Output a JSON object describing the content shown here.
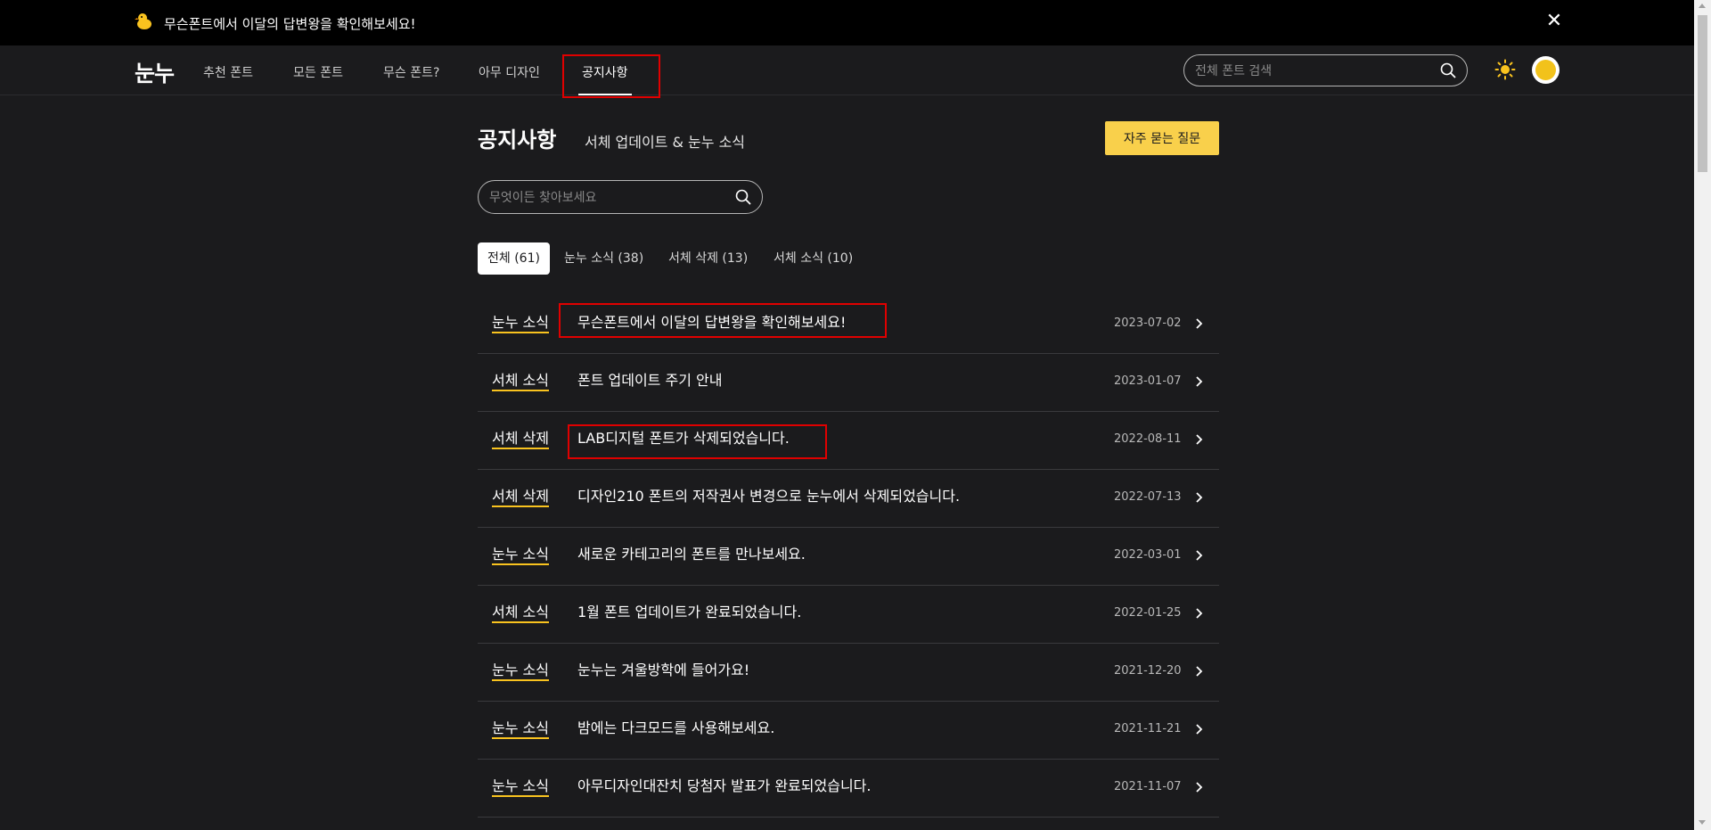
{
  "banner": {
    "text": "무슨폰트에서 이달의 답변왕을 확인해보세요!",
    "close": "✕"
  },
  "nav": {
    "logo": "눈누",
    "items": [
      {
        "label": "추천 폰트"
      },
      {
        "label": "모든 폰트"
      },
      {
        "label": "무슨 폰트?"
      },
      {
        "label": "아무 디자인"
      },
      {
        "label": "공지사항",
        "active": true
      }
    ],
    "search_placeholder": "전체 폰트 검색"
  },
  "page": {
    "title": "공지사항",
    "subtitle": "서체 업데이트 & 눈누 소식",
    "faq_button": "자주 묻는 질문",
    "search_placeholder": "무엇이든 찾아보세요"
  },
  "filters": [
    {
      "label": "전체 (61)",
      "active": true
    },
    {
      "label": "눈누 소식 (38)"
    },
    {
      "label": "서체 삭제 (13)"
    },
    {
      "label": "서체 소식 (10)"
    }
  ],
  "notices": [
    {
      "category": "눈누 소식",
      "title": "무슨폰트에서 이달의 답변왕을 확인해보세요!",
      "date": "2023-07-02"
    },
    {
      "category": "서체 소식",
      "title": "폰트 업데이트 주기 안내",
      "date": "2023-01-07"
    },
    {
      "category": "서체 삭제",
      "title": "LAB디지털 폰트가 삭제되었습니다.",
      "date": "2022-08-11"
    },
    {
      "category": "서체 삭제",
      "title": "디자인210 폰트의 저작권사 변경으로 눈누에서 삭제되었습니다.",
      "date": "2022-07-13"
    },
    {
      "category": "눈누 소식",
      "title": "새로운 카테고리의 폰트를 만나보세요.",
      "date": "2022-03-01"
    },
    {
      "category": "서체 소식",
      "title": "1월 폰트 업데이트가 완료되었습니다.",
      "date": "2022-01-25"
    },
    {
      "category": "눈누 소식",
      "title": "눈누는 겨울방학에 들어가요!",
      "date": "2021-12-20"
    },
    {
      "category": "눈누 소식",
      "title": "밤에는 다크모드를 사용해보세요.",
      "date": "2021-11-21"
    },
    {
      "category": "눈누 소식",
      "title": "아무디자인대잔치 당첨자 발표가 완료되었습니다.",
      "date": "2021-11-07"
    }
  ],
  "colors": {
    "background": "#1b1b1d",
    "accent": "#f9d04b",
    "highlight": "#e00000"
  },
  "icons": {
    "banner": "duck-icon",
    "close": "close-icon",
    "search": "search-icon",
    "theme": "sun-icon",
    "chevron": "chevron-right-icon"
  }
}
